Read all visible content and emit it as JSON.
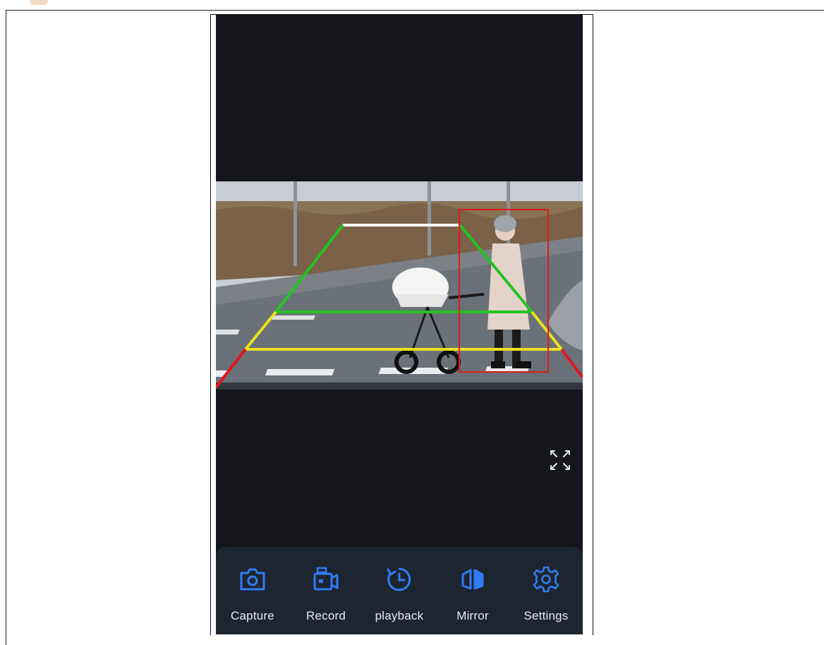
{
  "colors": {
    "accent": "#2f7cf6",
    "screen_bg": "#14161b",
    "toolbar_bg": "#1d2530",
    "guide_green": "#22c41f",
    "guide_yellow": "#e9e21c",
    "guide_red": "#e0161c",
    "guide_white": "#ffffff",
    "detection_box": "#e01a1a"
  },
  "viewer": {
    "fullscreen_icon": "fullscreen-expand-icon"
  },
  "toolbar": {
    "items": [
      {
        "label": "Capture",
        "icon": "camera-icon"
      },
      {
        "label": "Record",
        "icon": "video-record-icon"
      },
      {
        "label": "playback",
        "icon": "playback-history-icon"
      },
      {
        "label": "Mirror",
        "icon": "mirror-icon"
      },
      {
        "label": "Settings",
        "icon": "gear-icon"
      }
    ]
  }
}
